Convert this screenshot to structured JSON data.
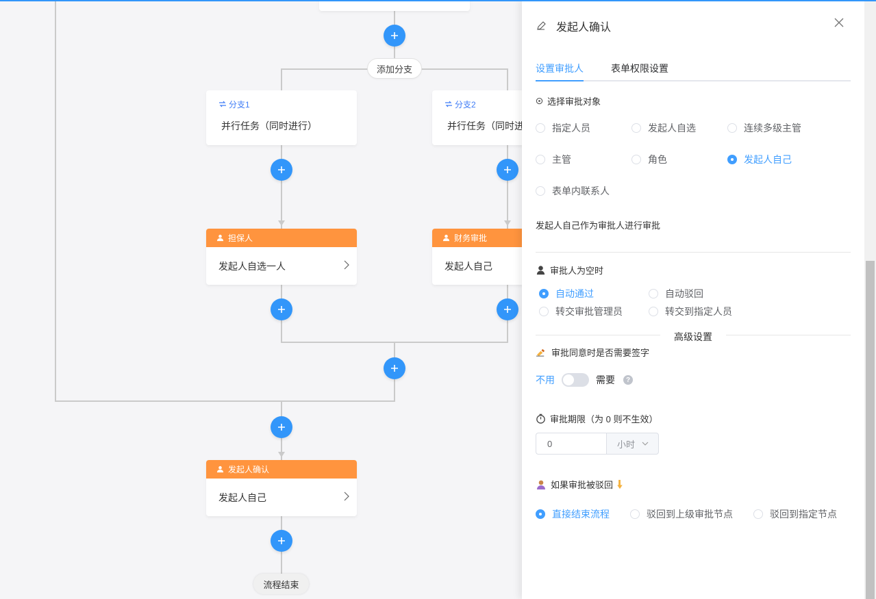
{
  "canvas": {
    "add_branch_label": "添加分支",
    "branches": [
      {
        "title": "分支1",
        "content": "并行任务（同时进行）"
      },
      {
        "title": "分支2",
        "content": "并行任务（同时进行）"
      }
    ],
    "branch_nodes": [
      {
        "title": "担保人",
        "content": "发起人自选一人"
      },
      {
        "title": "财务审批",
        "content": "发起人自己"
      }
    ],
    "confirm_node": {
      "title": "发起人确认",
      "content": "发起人自己"
    },
    "end_label": "流程结束"
  },
  "drawer": {
    "title": "发起人确认",
    "tabs": [
      "设置审批人",
      "表单权限设置"
    ],
    "active_tab": 0,
    "approver_section": {
      "title": "选择审批对象",
      "options": [
        "指定人员",
        "发起人自选",
        "连续多级主管",
        "主管",
        "角色",
        "发起人自己",
        "表单内联系人"
      ],
      "selected": "发起人自己",
      "hint": "发起人自己作为审批人进行审批"
    },
    "empty_section": {
      "title": "审批人为空时",
      "options": [
        "自动通过",
        "自动驳回",
        "转交审批管理员",
        "转交到指定人员"
      ],
      "selected": "自动通过"
    },
    "advanced_label": "高级设置",
    "signature": {
      "title": "审批同意时是否需要签字",
      "off_label": "不用",
      "on_label": "需要",
      "enabled": false
    },
    "timeout": {
      "title": "审批期限（为 0 则不生效）",
      "value": "0",
      "unit": "小时"
    },
    "reject": {
      "title": "如果审批被驳回",
      "options": [
        "直接结束流程",
        "驳回到上级审批节点",
        "驳回到指定节点"
      ],
      "selected": "直接结束流程"
    }
  },
  "colors": {
    "primary": "#3296fa",
    "accent": "#409eff",
    "approver_header": "#ff943e",
    "branch_title": "#3f7cf6"
  }
}
